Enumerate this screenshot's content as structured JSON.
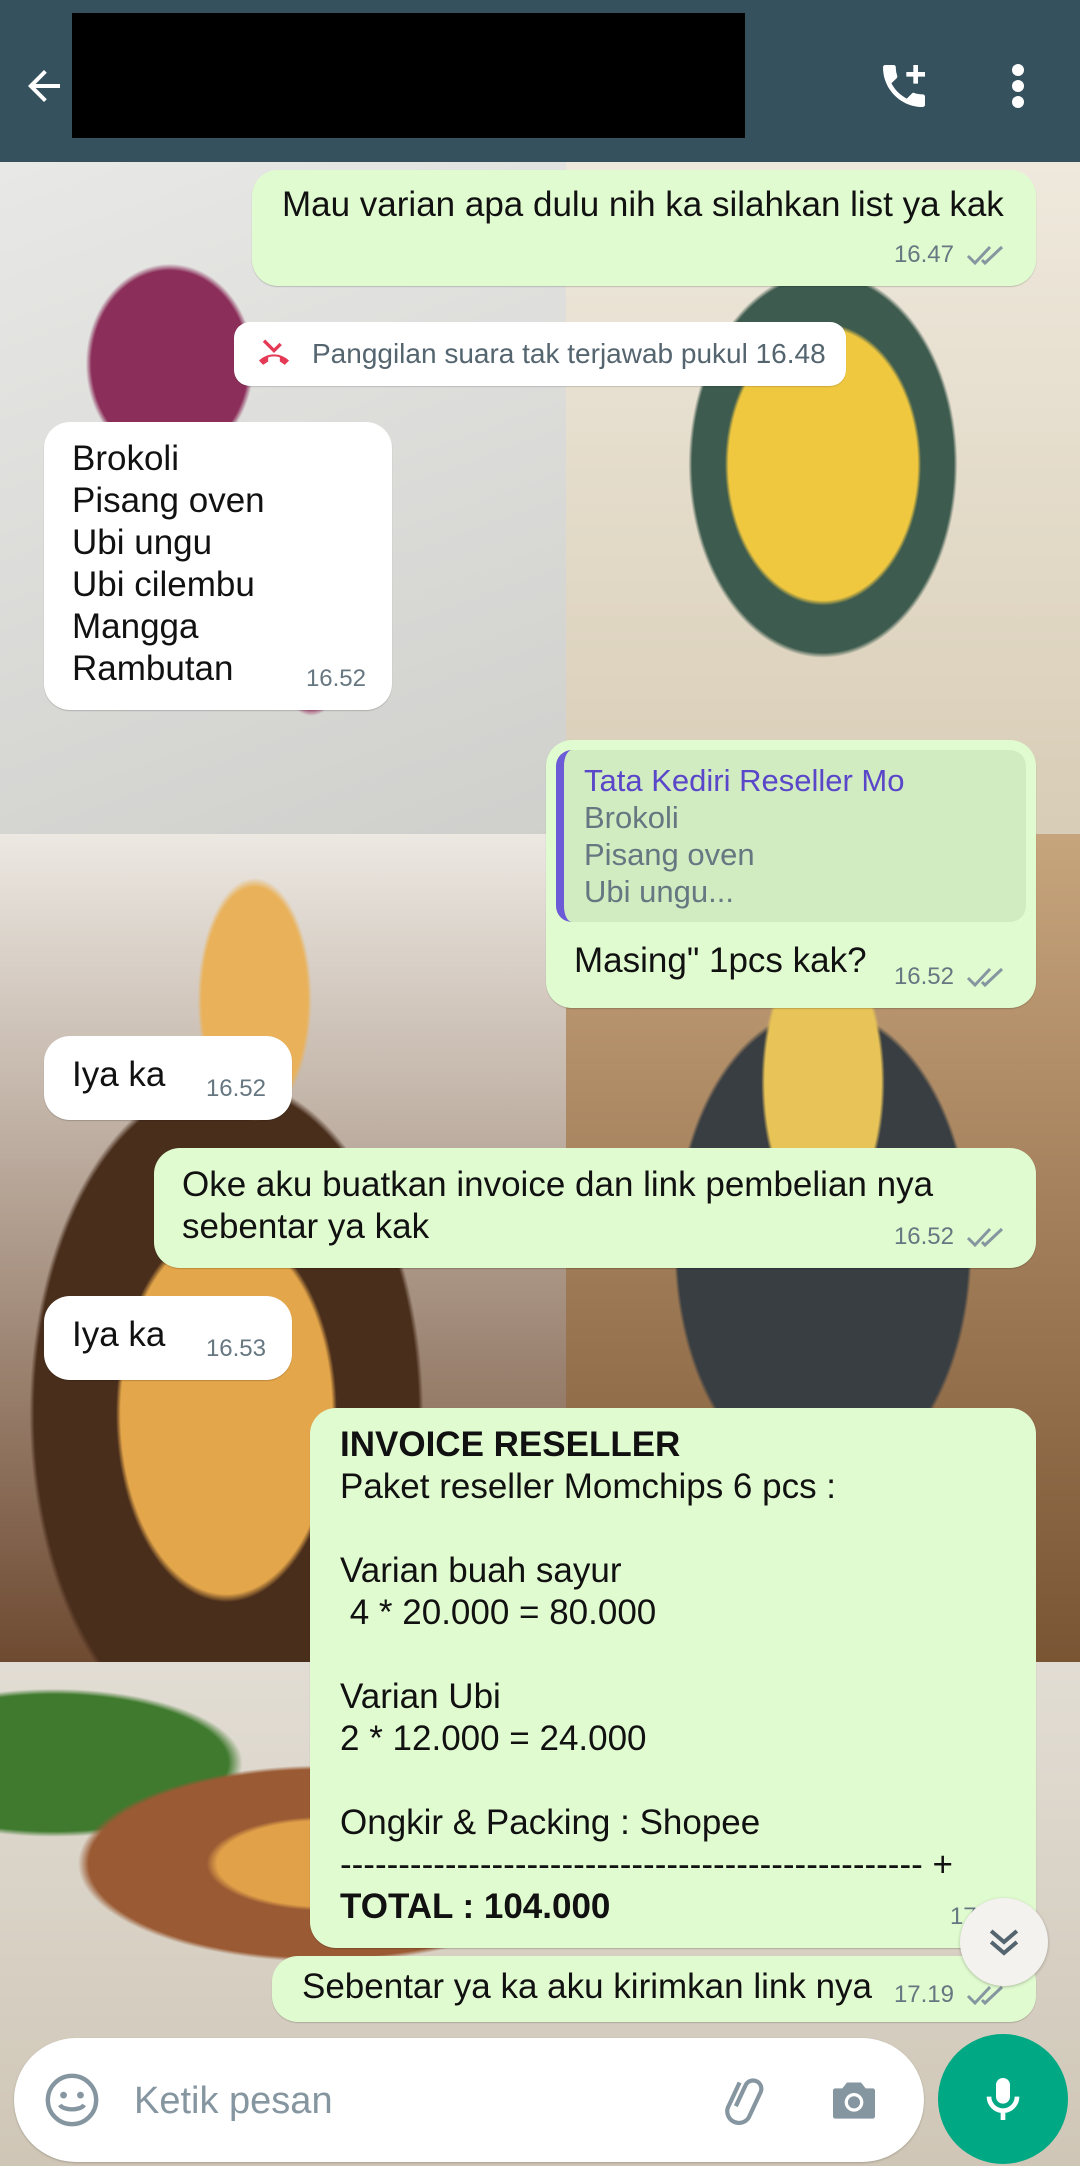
{
  "header": {
    "contact_name": "",
    "back_icon": "arrow-back-icon",
    "call_icon": "add-call-icon",
    "menu_icon": "more-vert-icon",
    "color": "#35515e"
  },
  "messages": [
    {
      "dir": "out",
      "text": "Mau varian apa dulu nih ka silahkan list ya kak",
      "time": "16.47"
    },
    {
      "dir": "system",
      "text": "Panggilan suara tak terjawab pukul 16.48",
      "icon": "missed-call-icon"
    },
    {
      "dir": "in",
      "text": "Brokoli\nPisang oven\nUbi ungu\nUbi cilembu\nMangga\nRambutan",
      "time": "16.52"
    },
    {
      "dir": "out",
      "quote_name": "Tata Kediri Reseller Mo",
      "quote_text": "Brokoli\nPisang oven\nUbi ungu...",
      "text": "Masing\" 1pcs kak?",
      "time": "16.52"
    },
    {
      "dir": "in",
      "text": "Iya ka",
      "time": "16.52"
    },
    {
      "dir": "out",
      "text": "Oke aku buatkan invoice dan link pembelian nya\nsebentar ya kak",
      "time": "16.52"
    },
    {
      "dir": "in",
      "text": "Iya ka",
      "time": "16.53"
    },
    {
      "dir": "out",
      "bold_title": "INVOICE RESELLER",
      "text": "Paket reseller Momchips 6 pcs :\n\nVarian buah sayur\n 4 * 20.000 = 80.000\n\nVarian Ubi\n2 * 12.000 = 24.000\n\nOngkir & Packing : Shopee\n-------------------------------------------------- +",
      "bold_total": "TOTAL : 104.000",
      "time": "17.19"
    },
    {
      "dir": "out",
      "text": "Sebentar ya ka aku kirimkan link nya",
      "time": "17.19"
    }
  ],
  "scroll_icon": "double-chevron-down-icon",
  "input": {
    "placeholder": "Ketik pesan",
    "value": "",
    "emoji_icon": "emoji-icon",
    "attach_icon": "paperclip-icon",
    "camera_icon": "camera-icon",
    "mic_icon": "mic-icon"
  },
  "colors": {
    "outgoing": "#e1fbd0",
    "incoming": "#ffffff",
    "accent": "#00a884",
    "tick": "#8696a0"
  }
}
